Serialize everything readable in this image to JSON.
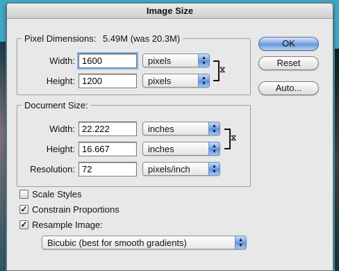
{
  "window": {
    "title": "Image Size"
  },
  "pixel_dimensions": {
    "title": "Pixel Dimensions:",
    "size_info": "5.49M (was 20.3M)",
    "width_label": "Width:",
    "width_value": "1600",
    "width_unit": "pixels",
    "height_label": "Height:",
    "height_value": "1200",
    "height_unit": "pixels"
  },
  "document_size": {
    "title": "Document Size:",
    "width_label": "Width:",
    "width_value": "22.222",
    "width_unit": "inches",
    "height_label": "Height:",
    "height_value": "16.667",
    "height_unit": "inches",
    "resolution_label": "Resolution:",
    "resolution_value": "72",
    "resolution_unit": "pixels/inch"
  },
  "options": {
    "scale_styles": {
      "label": "Scale Styles",
      "checked": false
    },
    "constrain_proportions": {
      "label": "Constrain Proportions",
      "checked": true
    },
    "resample_image": {
      "label": "Resample Image:",
      "checked": true
    },
    "resample_method": "Bicubic (best for smooth gradients)"
  },
  "buttons": {
    "ok": "OK",
    "reset": "Reset",
    "auto": "Auto..."
  }
}
